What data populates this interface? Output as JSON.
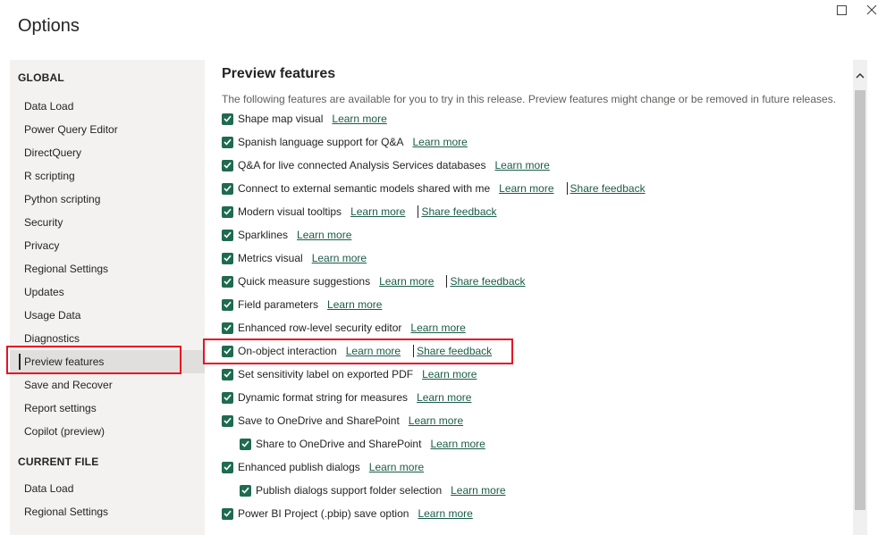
{
  "title": "Options",
  "window_controls": {
    "maximize_icon": "maximize-icon",
    "close_icon": "close-icon"
  },
  "sidebar": {
    "global_heading": "GLOBAL",
    "global_items": [
      {
        "label": "Data Load"
      },
      {
        "label": "Power Query Editor"
      },
      {
        "label": "DirectQuery"
      },
      {
        "label": "R scripting"
      },
      {
        "label": "Python scripting"
      },
      {
        "label": "Security"
      },
      {
        "label": "Privacy"
      },
      {
        "label": "Regional Settings"
      },
      {
        "label": "Updates"
      },
      {
        "label": "Usage Data"
      },
      {
        "label": "Diagnostics"
      },
      {
        "label": "Preview features",
        "selected": true
      },
      {
        "label": "Save and Recover"
      },
      {
        "label": "Report settings"
      },
      {
        "label": "Copilot (preview)"
      }
    ],
    "current_file_heading": "CURRENT FILE",
    "current_file_items": [
      {
        "label": "Data Load"
      },
      {
        "label": "Regional Settings"
      }
    ]
  },
  "main": {
    "heading": "Preview features",
    "description": "The following features are available for you to try in this release. Preview features might change or be removed in future releases.",
    "learn_more_label": "Learn more",
    "share_feedback_label": "Share feedback",
    "features": [
      {
        "label": "Shape map visual",
        "checked": true,
        "indent": 0,
        "feedback": false
      },
      {
        "label": "Spanish language support for Q&A",
        "checked": true,
        "indent": 0,
        "feedback": false
      },
      {
        "label": "Q&A for live connected Analysis Services databases",
        "checked": true,
        "indent": 0,
        "feedback": false
      },
      {
        "label": "Connect to external semantic models shared with me",
        "checked": true,
        "indent": 0,
        "feedback": true
      },
      {
        "label": "Modern visual tooltips",
        "checked": true,
        "indent": 0,
        "feedback": true
      },
      {
        "label": "Sparklines",
        "checked": true,
        "indent": 0,
        "feedback": false
      },
      {
        "label": "Metrics visual",
        "checked": true,
        "indent": 0,
        "feedback": false
      },
      {
        "label": "Quick measure suggestions",
        "checked": true,
        "indent": 0,
        "feedback": true
      },
      {
        "label": "Field parameters",
        "checked": true,
        "indent": 0,
        "feedback": false
      },
      {
        "label": "Enhanced row-level security editor",
        "checked": true,
        "indent": 0,
        "feedback": false
      },
      {
        "label": "On-object interaction",
        "checked": true,
        "indent": 0,
        "feedback": true
      },
      {
        "label": "Set sensitivity label on exported PDF",
        "checked": true,
        "indent": 0,
        "feedback": false
      },
      {
        "label": "Dynamic format string for measures",
        "checked": true,
        "indent": 0,
        "feedback": false
      },
      {
        "label": "Save to OneDrive and SharePoint",
        "checked": true,
        "indent": 0,
        "feedback": false
      },
      {
        "label": "Share to OneDrive and SharePoint",
        "checked": true,
        "indent": 1,
        "feedback": false
      },
      {
        "label": "Enhanced publish dialogs",
        "checked": true,
        "indent": 0,
        "feedback": false
      },
      {
        "label": "Publish dialogs support folder selection",
        "checked": true,
        "indent": 1,
        "feedback": false
      },
      {
        "label": "Power BI Project (.pbip) save option",
        "checked": true,
        "indent": 0,
        "feedback": false
      }
    ]
  },
  "colors": {
    "checkbox": "#1f6b4f",
    "link": "#1a5c48",
    "highlight": "#e81123",
    "sidebar_bg": "#f3f2f1"
  }
}
